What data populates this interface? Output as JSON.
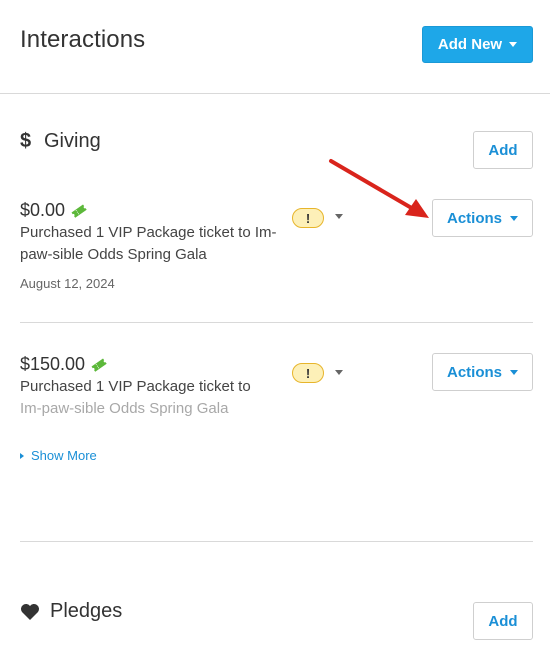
{
  "header": {
    "title": "Interactions",
    "add_new_label": "Add New"
  },
  "giving": {
    "title": "Giving",
    "icon": "dollar-icon",
    "add_label": "Add",
    "items": [
      {
        "amount": "$0.00",
        "description": "Purchased 1 VIP Package ticket to Im-paw-sible Odds Spring Gala",
        "date": "August 12, 2024",
        "badge": "!",
        "actions_label": "Actions"
      },
      {
        "amount": "$150.00",
        "description_line1": "Purchased 1 VIP Package ticket to",
        "description_line2": "Im-paw-sible Odds Spring Gala",
        "badge": "!",
        "actions_label": "Actions"
      }
    ],
    "show_more_label": "Show More"
  },
  "pledges": {
    "title": "Pledges",
    "icon": "heart-icon",
    "add_label": "Add"
  },
  "colors": {
    "primary_button": "#1ea7e8",
    "link": "#1a8fd6",
    "warning_badge_bg": "#fdf0b8",
    "warning_badge_border": "#e7b52b",
    "ticket_icon": "#5cb83a",
    "annotation_arrow": "#d9241c"
  }
}
